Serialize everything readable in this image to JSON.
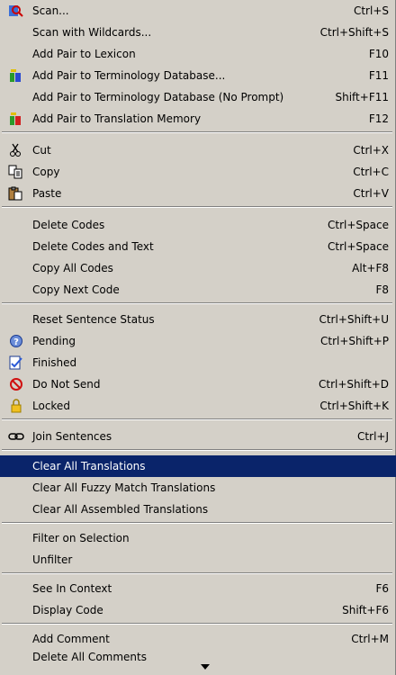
{
  "menu": {
    "items": [
      {
        "label": "Scan...",
        "shortcut": "Ctrl+S",
        "icon": "scan-magnifier-icon"
      },
      {
        "label": "Scan with Wildcards...",
        "shortcut": "Ctrl+Shift+S"
      },
      {
        "label": "Add Pair to Lexicon",
        "shortcut": "F10"
      },
      {
        "label": "Add Pair to Terminology Database...",
        "shortcut": "F11",
        "icon": "add-terminology-icon"
      },
      {
        "label": "Add Pair to Terminology Database (No Prompt)",
        "shortcut": "Shift+F11"
      },
      {
        "label": "Add Pair to Translation Memory",
        "shortcut": "F12",
        "icon": "add-translation-memory-icon"
      },
      {
        "label": "Cut",
        "shortcut": "Ctrl+X",
        "icon": "scissors-icon"
      },
      {
        "label": "Copy",
        "shortcut": "Ctrl+C",
        "icon": "copy-icon"
      },
      {
        "label": "Paste",
        "shortcut": "Ctrl+V",
        "icon": "paste-icon"
      },
      {
        "label": "Delete Codes",
        "shortcut": "Ctrl+Space"
      },
      {
        "label": "Delete Codes and Text",
        "shortcut": "Ctrl+Space"
      },
      {
        "label": "Copy All Codes",
        "shortcut": "Alt+F8"
      },
      {
        "label": "Copy Next Code",
        "shortcut": "F8"
      },
      {
        "label": "Reset Sentence Status",
        "shortcut": "Ctrl+Shift+U"
      },
      {
        "label": "Pending",
        "shortcut": "Ctrl+Shift+P",
        "icon": "pending-question-icon"
      },
      {
        "label": "Finished",
        "shortcut": "",
        "icon": "finished-document-icon"
      },
      {
        "label": "Do Not Send",
        "shortcut": "Ctrl+Shift+D",
        "icon": "no-entry-icon"
      },
      {
        "label": "Locked",
        "shortcut": "Ctrl+Shift+K",
        "icon": "lock-icon"
      },
      {
        "label": "Join Sentences",
        "shortcut": "Ctrl+J",
        "icon": "chain-link-icon"
      },
      {
        "label": "Clear All Translations",
        "shortcut": "",
        "highlighted": true
      },
      {
        "label": "Clear All Fuzzy Match Translations",
        "shortcut": ""
      },
      {
        "label": "Clear All Assembled Translations",
        "shortcut": ""
      },
      {
        "label": "Filter on Selection",
        "shortcut": ""
      },
      {
        "label": "Unfilter",
        "shortcut": ""
      },
      {
        "label": "See In Context",
        "shortcut": "F6"
      },
      {
        "label": "Display Code",
        "shortcut": "Shift+F6"
      },
      {
        "label": "Add Comment",
        "shortcut": "Ctrl+M"
      },
      {
        "label": "Delete All Comments",
        "shortcut": ""
      }
    ],
    "scroll_down_icon": "scroll-down-arrow-icon"
  },
  "colors": {
    "menu_bg": "#d4d0c8",
    "highlight_bg": "#0a246a",
    "highlight_text": "#ffffff"
  }
}
